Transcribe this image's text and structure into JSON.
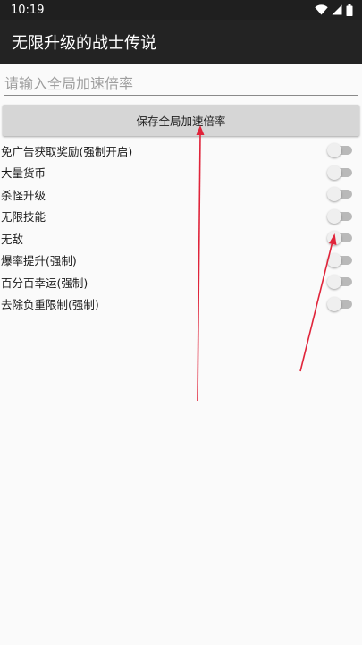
{
  "status_bar": {
    "time": "10:19",
    "icons": [
      "wifi-icon",
      "signal-icon",
      "battery-icon"
    ]
  },
  "app_bar": {
    "title": "无限升级的战士传说"
  },
  "speed_input": {
    "placeholder": "请输入全局加速倍率",
    "value": ""
  },
  "save_button": {
    "label": "保存全局加速倍率"
  },
  "toggles": [
    {
      "label": "免广告获取奖励(强制开启)",
      "on": false
    },
    {
      "label": "大量货币",
      "on": false
    },
    {
      "label": "杀怪升级",
      "on": false
    },
    {
      "label": "无限技能",
      "on": false
    },
    {
      "label": "无敌",
      "on": false
    },
    {
      "label": "爆率提升(强制)",
      "on": false
    },
    {
      "label": "百分百幸运(强制)",
      "on": false
    },
    {
      "label": "去除负重限制(强制)",
      "on": false
    }
  ],
  "colors": {
    "status_bar": "#1f1f1f",
    "app_bar": "#232323",
    "background": "#fafafa",
    "button": "#d6d6d6",
    "annotation_arrow": "#e0243a"
  }
}
